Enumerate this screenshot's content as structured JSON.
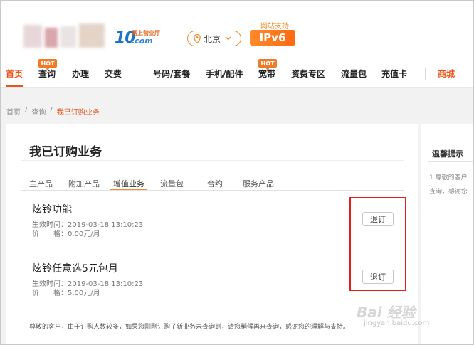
{
  "header": {
    "logo_number": "10",
    "logo_cn": "网上营业厅",
    "logo_com": ".com",
    "city": "北京",
    "ipv6_label": "网站支持",
    "ipv6_badge": "IPv6"
  },
  "nav": {
    "items": [
      "首页",
      "查询",
      "办理",
      "交费",
      "号码/套餐",
      "手机/配件",
      "宽带",
      "资费专区",
      "流量包",
      "充值卡",
      "商城"
    ],
    "hot_label": "HOT",
    "active_color": "#e8561f"
  },
  "breadcrumb": {
    "items": [
      "首页",
      "查询",
      "我已订购业务"
    ],
    "sep": "/"
  },
  "main": {
    "title": "我已订购业务",
    "tabs": [
      "主产品",
      "附加产品",
      "增值业务",
      "流量包",
      "合约",
      "服务产品"
    ],
    "active_tab": "增值业务",
    "rows": [
      {
        "name": "炫铃功能",
        "effective": "生效时间：2019-03-18 13:10:23",
        "price": "价　　格：0.00元/月",
        "action": "退订"
      },
      {
        "name": "炫铃任意选5元包月",
        "effective": "生效时间：2019-03-18 13:10:23",
        "price": "价　　格：5.00元/月",
        "action": "退订"
      }
    ],
    "notice": "尊敬的客户，由于订购人数较多，如果您刚刚订购了新业务未查询到，请您稍候再来查询，感谢您的理解与支持。"
  },
  "side": {
    "title": "温馨提示",
    "line1": "1.尊敬的客户",
    "line2": "查询，感谢您"
  },
  "watermark": {
    "main": "Bai 经验",
    "sub": "jingyan.baidu.com"
  },
  "colors": {
    "accent": "#f08a2a",
    "highlight": "#e01e1e"
  }
}
